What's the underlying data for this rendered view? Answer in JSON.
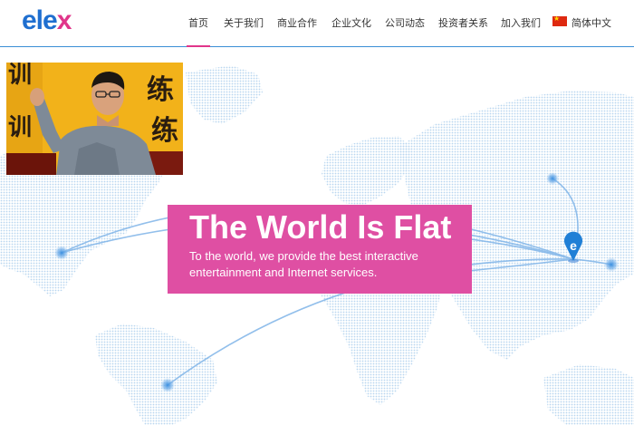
{
  "brand": {
    "logo_main": "ele",
    "logo_accent": "x"
  },
  "nav": {
    "items": [
      {
        "label": "首页",
        "active": true
      },
      {
        "label": "关于我们"
      },
      {
        "label": "商业合作"
      },
      {
        "label": "企业文化"
      },
      {
        "label": "公司动态"
      },
      {
        "label": "投资者关系"
      },
      {
        "label": "加入我们"
      }
    ],
    "language": {
      "label": "简体中文",
      "icon": "china-flag-icon"
    }
  },
  "hero": {
    "title": "The World Is Flat",
    "subtitle": "To the world, we provide the best interactive entertainment and Internet services.",
    "marker_letter": "e",
    "photo_chars": [
      "训",
      "训",
      "练",
      "练"
    ]
  },
  "colors": {
    "brand_blue": "#1f6fd0",
    "brand_pink": "#e0358a",
    "banner_pink": "#df4fa3",
    "map_dots": "#b9d6f0",
    "route": "#7fb4e8",
    "photo_bg": "#f2b21a"
  }
}
